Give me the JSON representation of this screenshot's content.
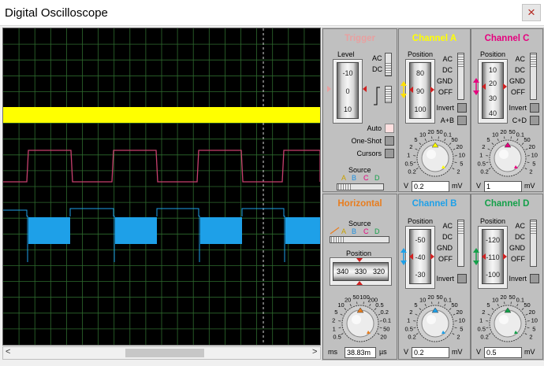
{
  "window": {
    "title": "Digital Oscilloscope",
    "close_glyph": "×"
  },
  "scope": {
    "grid_divisions": 20,
    "trace_colors": {
      "channel_a": "#ffff00",
      "channel_c": "#c8406e",
      "channel_b": "#1ea0e8"
    }
  },
  "trigger": {
    "title": "Trigger",
    "level_label": "Level",
    "level_ticks": [
      "-10",
      "0",
      "10"
    ],
    "coupling_ac": "AC",
    "coupling_dc": "DC",
    "mode_auto": "Auto",
    "mode_oneshot": "One-Shot",
    "cursors": "Cursors",
    "source_label": "Source",
    "source_letters": [
      "A",
      "B",
      "C",
      "D"
    ]
  },
  "channel_a": {
    "title": "Channel A",
    "color": "#ffff00",
    "position_label": "Position",
    "position_ticks": [
      "80",
      "90",
      "100"
    ],
    "ac": "AC",
    "dc": "DC",
    "gnd": "GND",
    "off": "OFF",
    "invert": "Invert",
    "combine": "A+B",
    "knob_scale": [
      "0.2",
      "0.5",
      "1",
      "2",
      "5",
      "10",
      "20",
      "50",
      "0.1",
      "50",
      "20",
      "10",
      "5",
      "2"
    ],
    "volts_unit_left": "V",
    "value": "0.2",
    "volts_unit_right": "mV"
  },
  "channel_c": {
    "title": "Channel C",
    "color": "#e6007e",
    "position_label": "Position",
    "position_ticks": [
      "10",
      "20",
      "30",
      "40"
    ],
    "ac": "AC",
    "dc": "DC",
    "gnd": "GND",
    "off": "OFF",
    "invert": "Invert",
    "combine": "C+D",
    "knob_scale": [
      "0.2",
      "0.5",
      "1",
      "2",
      "5",
      "10",
      "20",
      "50",
      "0.1",
      "50",
      "20",
      "10",
      "5",
      "2"
    ],
    "volts_unit_left": "V",
    "value": "1",
    "volts_unit_right": "mV"
  },
  "horizontal": {
    "title": "Horizontal",
    "color": "#e87d1e",
    "source_label": "Source",
    "source_letters": [
      "A",
      "B",
      "C",
      "D"
    ],
    "position_label": "Position",
    "position_ticks": [
      "340",
      "330",
      "320"
    ],
    "knob_scale": [
      "0.5",
      "1",
      "2",
      "5",
      "10",
      "20",
      "50",
      "100",
      "200",
      "0.5",
      "0.2",
      "0.1",
      "50",
      "20"
    ],
    "time_unit_left": "ms",
    "value": "38.83m",
    "time_unit_right": "µs"
  },
  "channel_b": {
    "title": "Channel B",
    "color": "#1ea0e8",
    "position_label": "Position",
    "position_ticks": [
      "-50",
      "-40",
      "-30"
    ],
    "ac": "AC",
    "dc": "DC",
    "gnd": "GND",
    "off": "OFF",
    "invert": "Invert",
    "knob_scale": [
      "0.2",
      "0.5",
      "1",
      "2",
      "5",
      "10",
      "20",
      "50",
      "0.1",
      "50",
      "20",
      "10",
      "5",
      "2"
    ],
    "volts_unit_left": "V",
    "value": "0.2",
    "volts_unit_right": "mV"
  },
  "channel_d": {
    "title": "Channel D",
    "color": "#13a049",
    "position_label": "Position",
    "position_ticks": [
      "-120",
      "-110",
      "-100"
    ],
    "ac": "AC",
    "dc": "DC",
    "gnd": "GND",
    "off": "OFF",
    "invert": "Invert",
    "knob_scale": [
      "0.2",
      "0.5",
      "1",
      "2",
      "5",
      "10",
      "20",
      "50",
      "0.1",
      "50",
      "20",
      "10",
      "5",
      "2"
    ],
    "volts_unit_left": "V",
    "value": "0.5",
    "volts_unit_right": "mV"
  },
  "icons": [
    "close-icon",
    "knob-icon",
    "scroll-left-icon",
    "scroll-right-icon",
    "trigger-edge-icon"
  ]
}
